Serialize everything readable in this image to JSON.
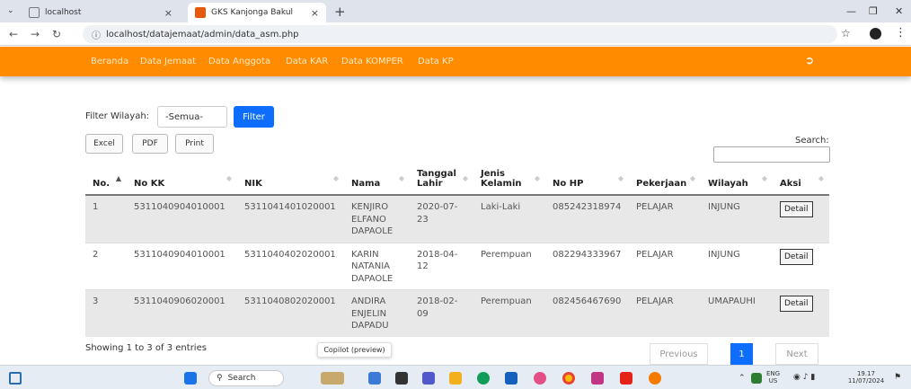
{
  "browser": {
    "tabs": [
      {
        "title": "localhost",
        "active": false
      },
      {
        "title": "GKS Kanjonga Bakul",
        "active": true
      }
    ],
    "url": "localhost/datajemaat/admin/data_asm.php"
  },
  "nav": {
    "links": [
      "Beranda",
      "Data Jemaat",
      "Data Anggota",
      "Data KAR",
      "Data KOMPER",
      "Data KP"
    ],
    "accent": "#ff8c00"
  },
  "filter": {
    "label": "Filter Wilayah:",
    "selected": "-Semua-",
    "button": "Filter"
  },
  "export": {
    "excel": "Excel",
    "pdf": "PDF",
    "print": "Print"
  },
  "search": {
    "label": "Search:",
    "value": ""
  },
  "table": {
    "headers": [
      "No.",
      "No KK",
      "NIK",
      "Nama",
      "Tanggal Lahir",
      "Jenis Kelamin",
      "No HP",
      "Pekerjaan",
      "Wilayah",
      "Aksi"
    ],
    "rows": [
      [
        "1",
        "5311040904010001",
        "5311041401020001",
        "KENJIRO ELFANO DAPAOLE",
        "2020-07-23",
        "Laki-Laki",
        "085242318974",
        "PELAJAR",
        "INJUNG",
        "Detail"
      ],
      [
        "2",
        "5311040904010001",
        "5311040402020001",
        "KARIN NATANIA DAPAOLE",
        "2018-04-12",
        "Perempuan",
        "082294333967",
        "PELAJAR",
        "INJUNG",
        "Detail"
      ],
      [
        "3",
        "5311040906020001",
        "5311040802020001",
        "ANDIRA ENJELIN DAPADU",
        "2018-02-09",
        "Perempuan",
        "082456467690",
        "PELAJAR",
        "UMAPAUHI",
        "Detail"
      ]
    ]
  },
  "footer": {
    "info": "Showing 1 to 3 of 3 entries",
    "copilot": "Copilot (preview)",
    "previous": "Previous",
    "current_page": "1",
    "next": "Next"
  },
  "taskbar": {
    "search_placeholder": "Search",
    "lang": "ENG",
    "region": "US",
    "time": "19.17",
    "date": "11/07/2024"
  }
}
